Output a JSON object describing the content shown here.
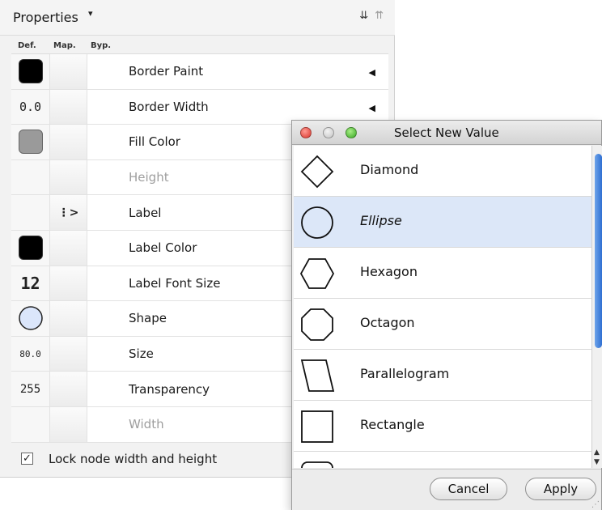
{
  "panel": {
    "title": "Properties",
    "columns": {
      "def": "Def.",
      "map": "Map.",
      "byp": "Byp."
    },
    "rows": [
      {
        "name": "Border Paint",
        "has_arrow": true
      },
      {
        "name": "Border Width",
        "default_value": "0.0",
        "has_arrow": true
      },
      {
        "name": "Fill Color"
      },
      {
        "name": "Height",
        "disabled": true
      },
      {
        "name": "Label",
        "mapping_icon": "passthrough-mapping-icon"
      },
      {
        "name": "Label Color"
      },
      {
        "name": "Label Font Size",
        "default_value": "12"
      },
      {
        "name": "Shape",
        "default_icon": "ellipse-icon"
      },
      {
        "name": "Size",
        "default_value": "80.0"
      },
      {
        "name": "Transparency",
        "default_value": "255"
      },
      {
        "name": "Width",
        "disabled": true
      }
    ],
    "swatch_colors": {
      "border_paint": "#000000",
      "fill_color": "#9a9a9a",
      "label_color": "#000000",
      "shape_fill": "#dbe6fb"
    },
    "lock_label": "Lock node width and height",
    "lock_checked": true
  },
  "dialog": {
    "title": "Select New Value",
    "items": [
      {
        "label": "Diamond",
        "icon": "diamond-icon"
      },
      {
        "label": "Ellipse",
        "icon": "ellipse-icon",
        "selected": true
      },
      {
        "label": "Hexagon",
        "icon": "hexagon-icon"
      },
      {
        "label": "Octagon",
        "icon": "octagon-icon"
      },
      {
        "label": "Parallelogram",
        "icon": "parallelogram-icon"
      },
      {
        "label": "Rectangle",
        "icon": "rectangle-icon"
      }
    ],
    "cancel_label": "Cancel",
    "apply_label": "Apply",
    "selection_color": "#dce7f8"
  }
}
